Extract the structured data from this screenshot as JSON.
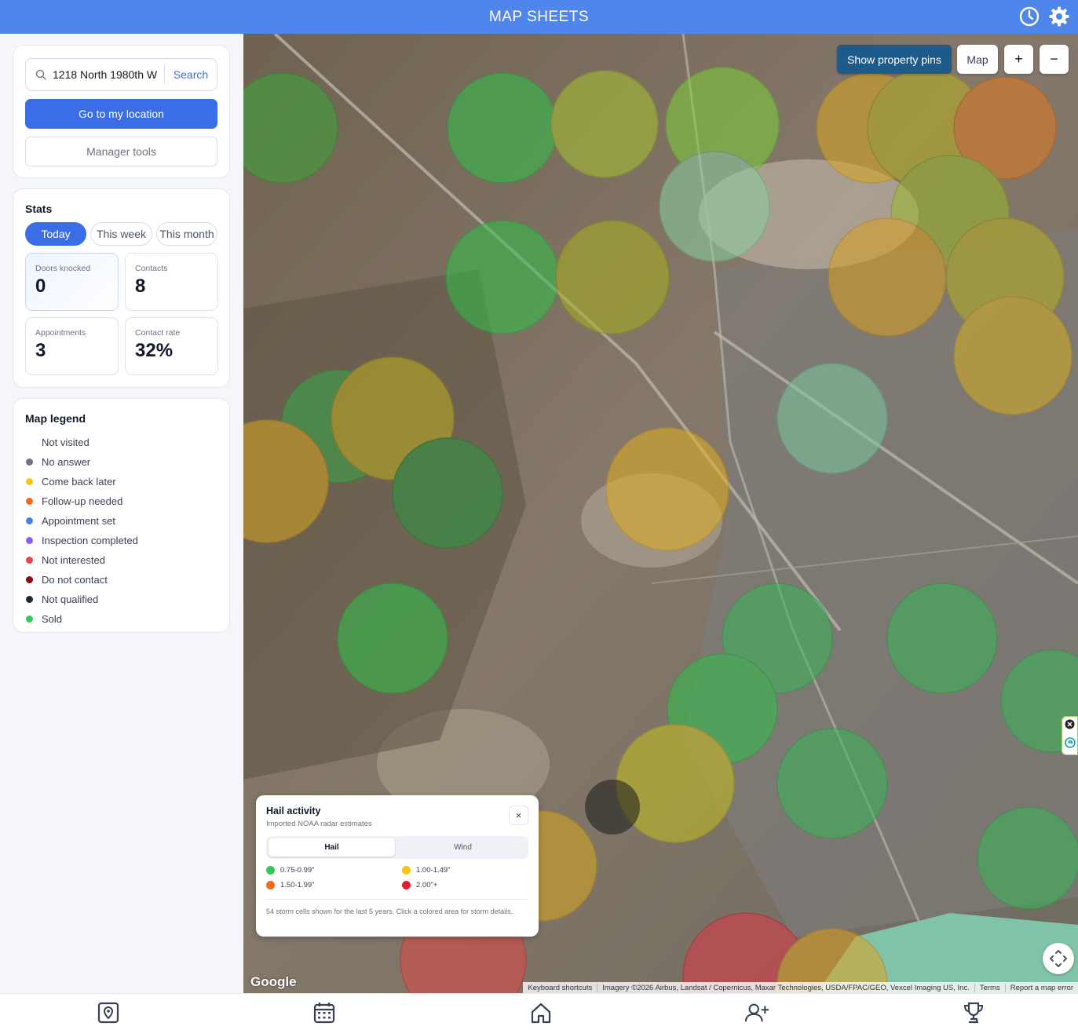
{
  "header": {
    "title": "MAP SHEETS",
    "icons": [
      "clock-icon",
      "gear-icon"
    ]
  },
  "search": {
    "value": "1218 North 1980th W",
    "button_label": "Search"
  },
  "actions": {
    "locate_label": "Go to my location",
    "manager_label": "Manager tools"
  },
  "stats": {
    "title": "Stats",
    "tabs": [
      {
        "label": "Today",
        "active": true
      },
      {
        "label": "This week",
        "active": false
      },
      {
        "label": "This month",
        "active": false
      }
    ],
    "cards": [
      {
        "label": "Doors knocked",
        "value": "0"
      },
      {
        "label": "Contacts",
        "value": "8"
      },
      {
        "label": "Appointments",
        "value": "3"
      },
      {
        "label": "Contact rate",
        "value": "32%"
      }
    ]
  },
  "legend": {
    "title": "Map legend",
    "items": [
      {
        "label": "Not visited",
        "color": "#ffffff"
      },
      {
        "label": "No answer",
        "color": "#6b7280"
      },
      {
        "label": "Come back later",
        "color": "#f5c518"
      },
      {
        "label": "Follow-up needed",
        "color": "#f26b1d"
      },
      {
        "label": "Appointment set",
        "color": "#4a7ff0"
      },
      {
        "label": "Inspection completed",
        "color": "#8b5cf6"
      },
      {
        "label": "Not interested",
        "color": "#ef4444"
      },
      {
        "label": "Do not contact",
        "color": "#8b0a1a"
      },
      {
        "label": "Not qualified",
        "color": "#1f2937"
      },
      {
        "label": "Sold",
        "color": "#34c759"
      }
    ]
  },
  "map": {
    "pins_label": "Show property pins",
    "type_label": "Map",
    "zoom_in": "+",
    "zoom_out": "−",
    "google_logo": "Google",
    "attribution": [
      "Keyboard shortcuts",
      "Imagery ©2026 Airbus, Landsat / Copernicus, Maxar Technologies, USDA/FPAC/GEO, Vexcel Imaging US, Inc.",
      "Terms",
      "Report a map error"
    ]
  },
  "hail_panel": {
    "title": "Hail activity",
    "subtitle": "Imported NOAA radar estimates",
    "close": "×",
    "tabs": [
      "Hail",
      "Wind"
    ],
    "scale": [
      {
        "label": "0.75-0.99\"",
        "color": "#34c759"
      },
      {
        "label": "1.00-1.49\"",
        "color": "#f5c518"
      },
      {
        "label": "1.50-1.99\"",
        "color": "#f26b1d"
      },
      {
        "label": "2.00\"+",
        "color": "#dc1f35"
      }
    ],
    "note": "54 storm cells shown for the last 5 years. Click a colored area for storm details."
  },
  "bottom_nav": [
    "map-pin-icon",
    "calendar-icon",
    "home-icon",
    "add-user-icon",
    "trophy-icon"
  ]
}
